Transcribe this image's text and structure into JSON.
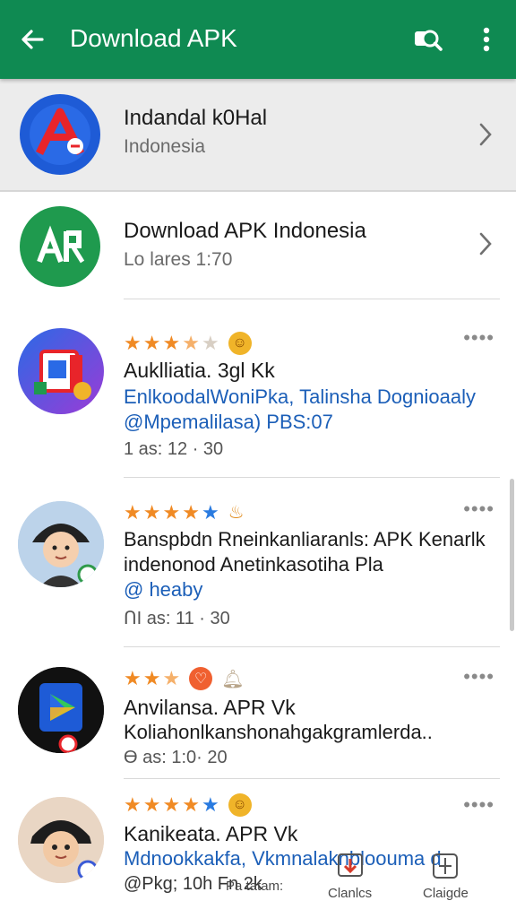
{
  "appbar": {
    "title": "Download APK",
    "back_icon": "arrow-back-icon",
    "search_icon": "search-icon",
    "more_icon": "more-vert-icon",
    "color": "#0f8a52"
  },
  "featured": [
    {
      "title": "Indandal k0Hal",
      "subtitle": "Indonesia",
      "icon": "app-icon-red-a",
      "color": "#1e5bd6"
    },
    {
      "title": "Download APK Indonesia",
      "subtitle": "Lo lares 1:70",
      "icon": "app-icon-apk",
      "color": "#1f9a4e"
    }
  ],
  "posts": [
    {
      "rating_stars": "★★★★★",
      "line1": "Auklliatia. 3gl Kk",
      "line2": "EnlkoodalWoniPka, Talinsha Dognioaaly",
      "line3": "@Mpemalilasa) PBS:07",
      "meta": "1 as: 12 · 30"
    },
    {
      "rating_stars": "★★★★★",
      "line1": "Banspbdn Rneinkanliaranls: APK Kenarlk",
      "line2": "indenonod Anetinkasotiha Pla",
      "line3": "@ heaby",
      "meta": "ՈI as: 11 · 30"
    },
    {
      "rating_stars": "★★★",
      "line1": "Anvilansa. APR Vk",
      "line2": "Koliahonlkanshonahgakgramlerda..",
      "meta": "Ɵ as: 1:0· 20"
    },
    {
      "rating_stars": "★★★★★",
      "line1": "Kanikeata. APR Vk",
      "line2": "Mdnookkakfa, Vkmnalaknbloouma d",
      "line3": "@Pkg; 10h Fn 2k"
    }
  ],
  "bottom_nav": [
    {
      "label": "Pa tatam:",
      "icon": "profile-icon"
    },
    {
      "label": "Clanlcs",
      "icon": "download-pin-icon"
    },
    {
      "label": "Claigde",
      "icon": "split-doc-icon"
    }
  ]
}
